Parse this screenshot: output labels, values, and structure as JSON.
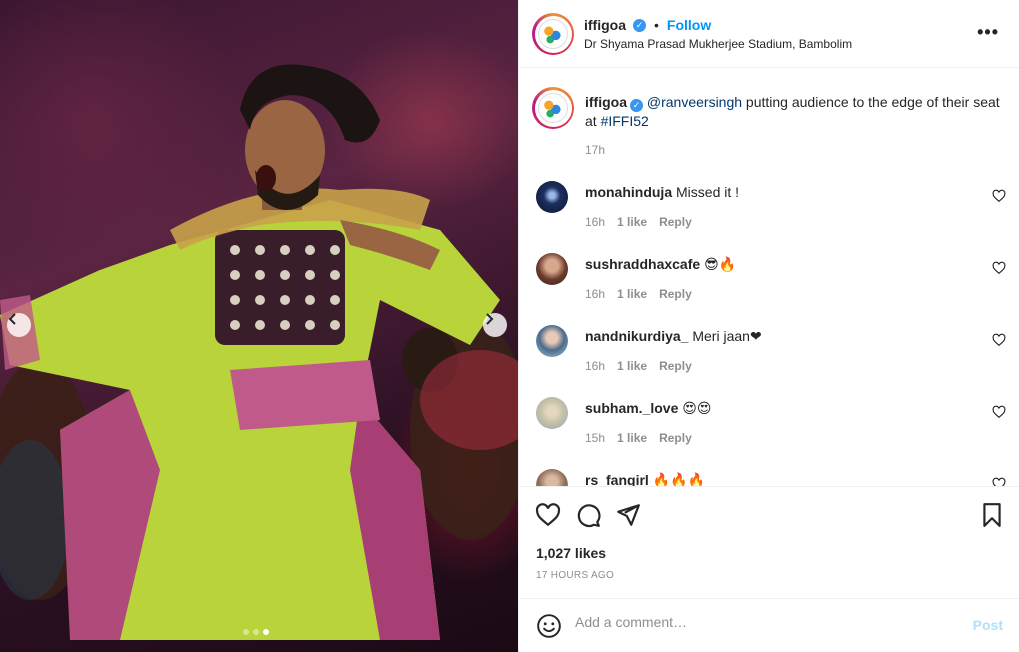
{
  "post": {
    "image_alt": "performer in green costume dancing on stage",
    "carousel_dots": 3,
    "active_dot": 3
  },
  "header": {
    "username": "iffigoa",
    "verified": true,
    "separator": "•",
    "follow_label": "Follow",
    "location": "Dr Shyama Prasad Mukherjee Stadium, Bambolim",
    "more_icon": "more-options-icon"
  },
  "caption": {
    "username": "iffigoa",
    "mention": "@ranveersingh",
    "text_middle": " putting audience to the edge of their seat at ",
    "hashtag": "#IFFI52",
    "time": "17h"
  },
  "comments": [
    {
      "username": "monahinduja",
      "text": "Missed it !",
      "time": "16h",
      "likes": "1 like",
      "reply": "Reply"
    },
    {
      "username": "sushraddhaxcafe",
      "text": "😎🔥",
      "time": "16h",
      "likes": "1 like",
      "reply": "Reply"
    },
    {
      "username": "nandnikurdiya_",
      "text": "Meri jaan❤",
      "time": "16h",
      "likes": "1 like",
      "reply": "Reply"
    },
    {
      "username": "subham._love",
      "text": "😍😍",
      "time": "15h",
      "likes": "1 like",
      "reply": "Reply"
    },
    {
      "username": "rs_fangirl",
      "text": "🔥🔥🔥",
      "time": "",
      "likes": "",
      "reply": ""
    }
  ],
  "actions": {
    "like_icon": "heart-icon",
    "comment_icon": "comment-icon",
    "share_icon": "share-icon",
    "save_icon": "bookmark-icon"
  },
  "likes_text": "1,027 likes",
  "posted_text": "17 HOURS AGO",
  "add_comment": {
    "placeholder": "Add a comment…",
    "post_label": "Post"
  },
  "colors": {
    "accent": "#0095f6",
    "link": "#00376b",
    "muted": "#8e8e8e",
    "post_disabled": "#b2dffc"
  }
}
